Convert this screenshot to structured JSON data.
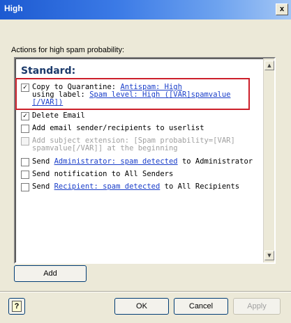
{
  "window": {
    "title": "High",
    "close_label": "x"
  },
  "section_label": "Actions for high spam probability:",
  "list": {
    "heading": "Standard:",
    "items": [
      {
        "checked": true,
        "disabled": false,
        "line1_prefix": "Copy to Quarantine: ",
        "line1_link": "Antispam: High",
        "line2_prefix": "using label: ",
        "line2_link": "Spam level: High ([VAR]spamvalue",
        "line3_link": "[/VAR])"
      },
      {
        "checked": true,
        "disabled": false,
        "text": "Delete Email"
      },
      {
        "checked": false,
        "disabled": false,
        "text": "Add email sender/recipients to userlist"
      },
      {
        "checked": false,
        "disabled": true,
        "line1": "Add subject extension: [Spam probability=[VAR]",
        "line2": "spamvalue[/VAR]] at the beginning"
      },
      {
        "checked": false,
        "disabled": false,
        "prefix": "Send ",
        "link": "Administrator: spam detected",
        "suffix": " to Administrator"
      },
      {
        "checked": false,
        "disabled": false,
        "text": "Send notification to All Senders"
      },
      {
        "checked": false,
        "disabled": false,
        "prefix": "Send ",
        "link": "Recipient: spam detected",
        "suffix": " to All Recipients"
      }
    ],
    "check_mark": "✓"
  },
  "buttons": {
    "add": "Add",
    "ok": "OK",
    "cancel": "Cancel",
    "apply": "Apply",
    "help_icon": "?"
  },
  "scrollbar": {
    "up_arrow": "▲",
    "down_arrow": "▼"
  },
  "colors": {
    "titlebar": "#1d5ad1",
    "highlight_border": "#cc1f2a",
    "link": "#1a3ec9",
    "heading": "#1b3a6b"
  }
}
